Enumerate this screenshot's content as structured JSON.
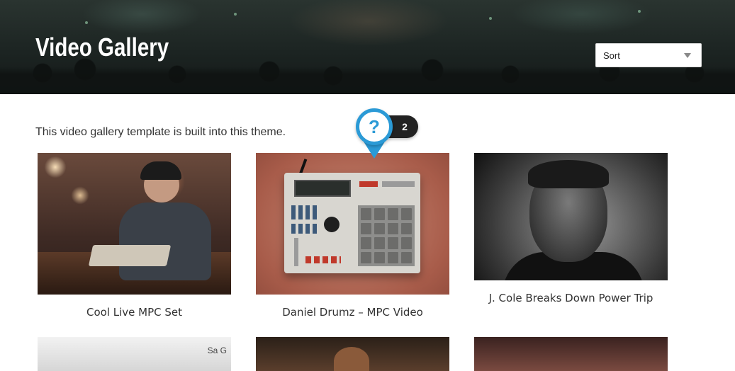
{
  "header": {
    "title": "Video Gallery",
    "sort": {
      "selected": "Sort"
    }
  },
  "intro": "This video gallery template is built into this theme.",
  "help": {
    "icon": "question-icon",
    "glyph": "?",
    "count": "2",
    "color": "#2b9ad6"
  },
  "videos": [
    {
      "title": "Cool Live MPC Set"
    },
    {
      "title": "Daniel Drumz – MPC Video"
    },
    {
      "title": "J. Cole Breaks Down Power Trip"
    },
    {
      "title": "",
      "partial_text": "Sa G"
    },
    {
      "title": ""
    },
    {
      "title": ""
    }
  ]
}
